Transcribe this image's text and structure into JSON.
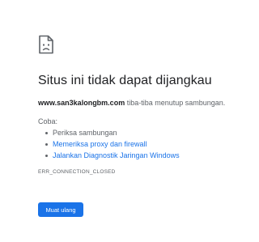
{
  "icon": "sad-page-icon",
  "colors": {
    "link": "#1a73e8",
    "button_bg": "#1a73e8",
    "text_primary": "#202124",
    "text_secondary": "#5f6368"
  },
  "error": {
    "title": "Situs ini tidak dapat dijangkau",
    "host": "www.san3kalongbm.com",
    "message": " tiba-tiba menutup sambungan.",
    "try_label": "Coba:",
    "suggestions": [
      {
        "label": "Periksa sambungan",
        "link": false
      },
      {
        "label": "Memeriksa proxy dan firewall",
        "link": true
      },
      {
        "label": "Jalankan Diagnostik Jaringan Windows",
        "link": true
      }
    ],
    "code": "ERR_CONNECTION_CLOSED"
  },
  "actions": {
    "reload_label": "Muat ulang"
  }
}
